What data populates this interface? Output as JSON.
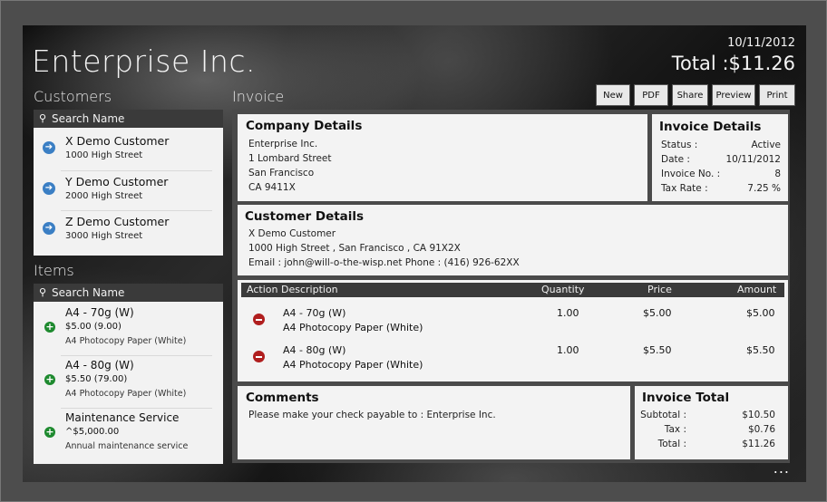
{
  "app": {
    "title": "Enterprise Inc.",
    "date": "10/11/2012",
    "total": "Total :$11.26"
  },
  "customers": {
    "heading": "Customers",
    "search_placeholder": "Search Name",
    "items": [
      {
        "name": "X Demo Customer",
        "address": "1000 High Street"
      },
      {
        "name": "Y Demo Customer",
        "address": "2000 High Street"
      },
      {
        "name": "Z Demo Customer",
        "address": "3000 High Street"
      }
    ]
  },
  "items": {
    "heading": "Items",
    "search_placeholder": "Search Name",
    "list": [
      {
        "name": "A4 - 70g (W)",
        "price": "$5.00  (9.00)",
        "desc": "A4 Photocopy Paper (White)"
      },
      {
        "name": "A4 - 80g (W)",
        "price": "$5.50  (79.00)",
        "desc": "A4 Photocopy Paper (White)"
      },
      {
        "name": "Maintenance Service",
        "price": "^$5,000.00",
        "desc": "Annual maintenance service"
      }
    ]
  },
  "invoice": {
    "heading": "Invoice",
    "buttons": {
      "new": "New",
      "pdf": "PDF",
      "share": "Share",
      "preview": "Preview",
      "print": "Print"
    },
    "company": {
      "title": "Company Details",
      "lines": [
        "Enterprise Inc.",
        "1 Lombard Street",
        "San Francisco",
        "CA 9411X"
      ]
    },
    "details": {
      "title": "Invoice Details",
      "status_label": "Status :",
      "status": "Active",
      "date_label": "Date :",
      "date": "10/11/2012",
      "number_label": "Invoice No. :",
      "number": "8",
      "tax_label": "Tax Rate :",
      "tax": "7.25 %"
    },
    "customer": {
      "title": "Customer Details",
      "name": "X Demo Customer",
      "address": "1000 High Street , San Francisco , CA 91X2X",
      "contact": "Email : john@will-o-the-wisp.net  Phone : (416) 926-62XX"
    },
    "table": {
      "headers": {
        "action": "Action",
        "description": "Description",
        "quantity": "Quantity",
        "price": "Price",
        "amount": "Amount"
      },
      "rows": [
        {
          "name": "A4 - 70g (W)",
          "desc": "A4 Photocopy Paper (White)",
          "quantity": "1.00",
          "price": "$5.00",
          "amount": "$5.00"
        },
        {
          "name": "A4 - 80g (W)",
          "desc": "A4 Photocopy Paper (White)",
          "quantity": "1.00",
          "price": "$5.50",
          "amount": "$5.50"
        }
      ]
    },
    "comments": {
      "title": "Comments",
      "text": "Please make your check payable to : Enterprise Inc."
    },
    "totals": {
      "title": "Invoice Total",
      "subtotal_label": "Subtotal :",
      "subtotal": "$10.50",
      "tax_label": "Tax :",
      "tax": "$0.76",
      "total_label": "Total :",
      "total": "$11.26"
    }
  },
  "more_label": "..."
}
